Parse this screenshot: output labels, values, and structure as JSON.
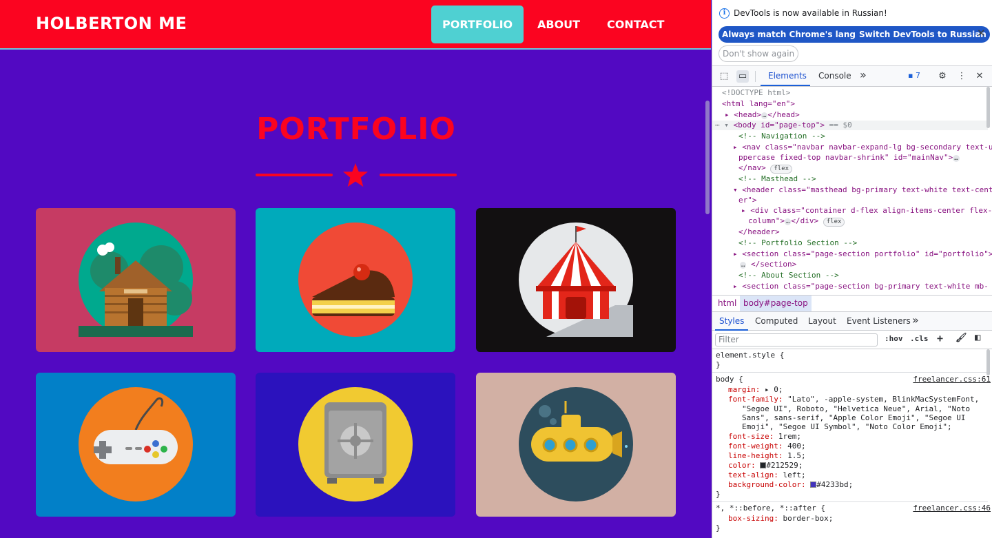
{
  "site": {
    "brand": "HOLBERTON ME",
    "nav": [
      {
        "label": "PORTFOLIO",
        "active": true
      },
      {
        "label": "ABOUT",
        "active": false
      },
      {
        "label": "CONTACT",
        "active": false
      }
    ],
    "section_title": "PORTFOLIO",
    "portfolio_items": [
      {
        "name": "cabin",
        "icon": "log-cabin-icon",
        "bg": "#c63b63",
        "circle": "#00a98e"
      },
      {
        "name": "cake",
        "icon": "cake-slice-icon",
        "bg": "#00aabb",
        "circle": "#f04a36"
      },
      {
        "name": "circus",
        "icon": "circus-tent-icon",
        "bg": "#121011",
        "circle": "#e6e8ea"
      },
      {
        "name": "game",
        "icon": "game-controller-icon",
        "bg": "#0280c8",
        "circle": "#f27e1e"
      },
      {
        "name": "safe",
        "icon": "safe-icon",
        "bg": "#2b12bd",
        "circle": "#f1ca31"
      },
      {
        "name": "submarine",
        "icon": "submarine-icon",
        "bg": "#d2b0a4",
        "circle": "#2d4d5d"
      }
    ],
    "colors": {
      "navbar": "#fb0420",
      "page_bg": "#5209c2",
      "accent": "#fb0420",
      "active_nav": "#4fd0d2"
    }
  },
  "devtools": {
    "info_message": "DevTools is now available in Russian!",
    "buttons": {
      "match_language": "Always match Chrome's language",
      "switch_language": "Switch DevTools to Russian",
      "dont_show": "Don't show again"
    },
    "tabs": {
      "elements": "Elements",
      "console": "Console",
      "more": "»"
    },
    "issues_count": "7",
    "dom": {
      "doctype": "<!DOCTYPE html>",
      "html_open": "<html lang=\"en\">",
      "head": "<head>",
      "head_close": "</head>",
      "body_open": "<body id=\"page-top\">",
      "body_marker": "== $0",
      "comment_nav": "<!-- Navigation -->",
      "nav_line1": "<nav class=\"navbar navbar-expand-lg bg-secondary text-u",
      "nav_line2": "ppercase fixed-top navbar-shrink\" id=\"mainNav\">",
      "nav_close": "</nav>",
      "chip_flex": "flex",
      "comment_masthead": "<!-- Masthead -->",
      "header_line1": "<header class=\"masthead bg-primary text-white text-cent",
      "header_line2": "er\">",
      "div_line1": "<div class=\"container d-flex align-items-center flex-",
      "div_line2": "column\">",
      "div_close": "</div>",
      "header_close": "</header>",
      "comment_portfolio": "<!-- Portfolio Section -->",
      "section_portfolio": "<section class=\"page-section portfolio\" id=\"portfolio\">",
      "section_close": "</section>",
      "comment_about": "<!-- About Section -->",
      "section_about": "<section class=\"page-section bg-primary text-white mb-"
    },
    "breadcrumbs": [
      "html",
      "body#page-top"
    ],
    "subtabs": [
      "Styles",
      "Computed",
      "Layout",
      "Event Listeners",
      "»"
    ],
    "filter_placeholder": "Filter",
    "filter_tools": {
      "hov": ":hov",
      "cls": ".cls",
      "add": "+"
    },
    "styles": {
      "element_style": "element.style {",
      "close_brace": "}",
      "body_selector": "body {",
      "body_source": "freelancer.css:61",
      "margin": "margin:",
      "margin_val": "0;",
      "font_family": "font-family:",
      "font_family_l1": "\"Lato\", -apple-system, BlinkMacSystemFont,",
      "font_family_l2": "\"Segoe UI\", Roboto, \"Helvetica Neue\", Arial, \"Noto",
      "font_family_l3": "Sans\", sans-serif, \"Apple Color Emoji\", \"Segoe UI",
      "font_family_l4": "Emoji\", \"Segoe UI Symbol\", \"Noto Color Emoji\";",
      "font_size": "font-size:",
      "font_size_val": "1rem;",
      "font_weight": "font-weight:",
      "font_weight_val": "400;",
      "line_height": "line-height:",
      "line_height_val": "1.5;",
      "color": "color:",
      "color_val": "#212529;",
      "color_swatch": "#212529",
      "text_align": "text-align:",
      "text_align_val": "left;",
      "bg_color": "background-color:",
      "bg_color_val": "#4233bd;",
      "bg_swatch": "#4233bd",
      "universal_selector": "*, *::before, *::after {",
      "universal_source": "freelancer.css:46",
      "box_sizing": "box-sizing:",
      "box_sizing_val": "border-box;"
    }
  }
}
